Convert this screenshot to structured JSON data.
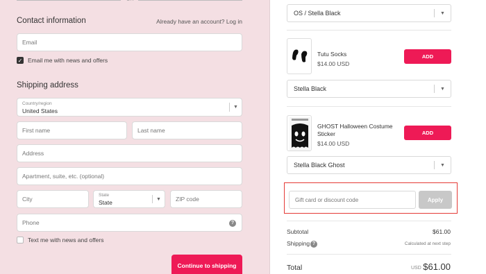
{
  "divider_text": "OR",
  "contact": {
    "heading": "Contact information",
    "account_prompt": "Already have an account?",
    "login_link": "Log in",
    "email_placeholder": "Email",
    "email_news_label": "Email me with news and offers",
    "email_news_checked": true
  },
  "shipping": {
    "heading": "Shipping address",
    "country_label": "Country/region",
    "country_value": "United States",
    "first_name_placeholder": "First name",
    "last_name_placeholder": "Last name",
    "address_placeholder": "Address",
    "apartment_placeholder": "Apartment, suite, etc. (optional)",
    "city_placeholder": "City",
    "state_label": "State",
    "state_value": "State",
    "zip_placeholder": "ZIP code",
    "phone_placeholder": "Phone",
    "text_news_label": "Text me with news and offers",
    "text_news_checked": false,
    "continue_label": "Continue to shipping"
  },
  "upsell": {
    "top_select_value": "OS / Stella Black",
    "products": [
      {
        "name": "Tutu Socks",
        "price": "$14.00 USD",
        "add_label": "ADD",
        "variant": "Stella Black"
      },
      {
        "name": "GHOST Halloween Costume Sticker",
        "price": "$14.00 USD",
        "add_label": "ADD",
        "variant": "Stella Black Ghost"
      }
    ]
  },
  "discount": {
    "placeholder": "Gift card or discount code",
    "apply_label": "Apply"
  },
  "summary": {
    "subtotal_label": "Subtotal",
    "subtotal_value": "$61.00",
    "shipping_label": "Shipping",
    "shipping_value": "Calculated at next step",
    "total_label": "Total",
    "currency": "USD",
    "total_value": "$61.00"
  },
  "colors": {
    "accent": "#ee1a56",
    "left_background": "#f4dfe3",
    "highlight_box": "#e53935"
  },
  "icons": {
    "chevron": "chevron-down-icon",
    "help": "help-circle-icon",
    "check": "checkmark-icon"
  }
}
